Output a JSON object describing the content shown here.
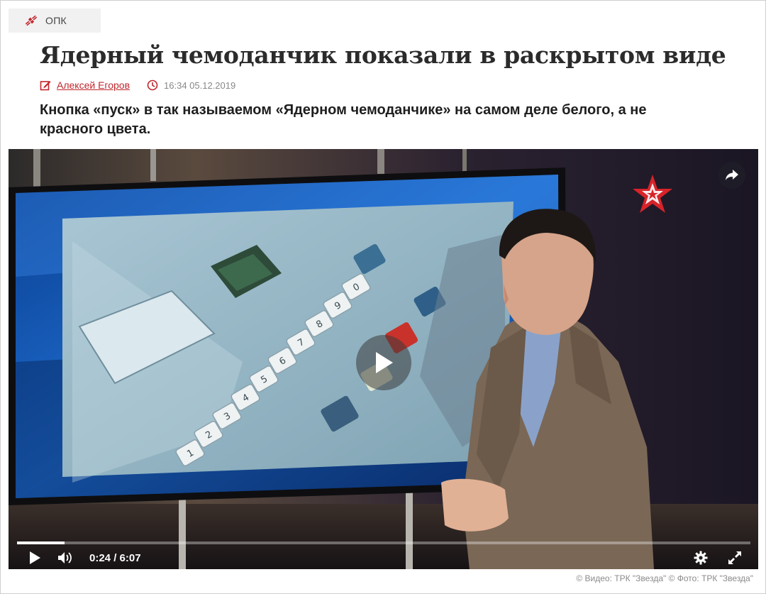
{
  "category": {
    "label": "ОПК",
    "icon": "satellite-icon"
  },
  "article": {
    "title": "Ядерный чемоданчик показали в раскрытом виде",
    "author": "Алексей Егоров",
    "datetime": "16:34 05.12.2019",
    "lead": "Кнопка «пуск» в так называемом «Ядерном чемоданчике» на самом деле белого, а не красного цвета."
  },
  "video": {
    "current_time": "0:24",
    "separator": " / ",
    "duration": "6:07",
    "progress_percent": 6.5,
    "keypad_digits": [
      "1",
      "2",
      "3",
      "4",
      "5",
      "6",
      "7",
      "8",
      "9",
      "0"
    ]
  },
  "credit": "© Видео: ТРК \"Звезда\" © Фото: ТРК \"Звезда\"",
  "colors": {
    "accent": "#c0262d",
    "title": "#2b2b2b",
    "meta": "#888888"
  }
}
